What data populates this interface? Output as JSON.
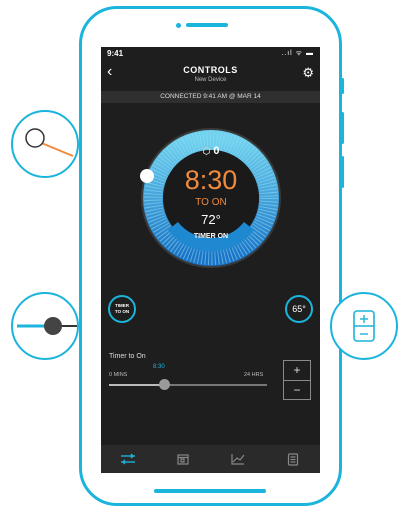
{
  "status_bar": {
    "time": "9:41",
    "signal": "..ıl ᯤ ▬"
  },
  "header": {
    "title": "CONTROLS",
    "subtitle": "New Device",
    "back_icon": "chevron-left-icon",
    "settings_icon": "gear-icon"
  },
  "connection": {
    "text": "CONNECTED 9:41 AM @ MAR 14"
  },
  "dial": {
    "count": "0",
    "count_icon": "hexagon-icon",
    "time": "8:30",
    "mode": "TO ON",
    "temperature": "72°",
    "status": "TIMER ON",
    "accent": "#1bb4dc",
    "time_color": "#f08a3c"
  },
  "left_button": {
    "line1": "TIMER",
    "line2": "TO ON"
  },
  "right_button": {
    "label": "65°"
  },
  "slider": {
    "title": "Timer to On",
    "min_label": "0 MINS",
    "max_label": "24 HRS",
    "value_label": "8:30",
    "value_fraction": 0.35
  },
  "stepper": {
    "plus": "+",
    "minus": "−"
  },
  "tabs": [
    {
      "icon": "sliders-icon",
      "active": true
    },
    {
      "icon": "calendar-icon",
      "active": false
    },
    {
      "icon": "chart-icon",
      "active": false
    },
    {
      "icon": "list-icon",
      "active": false
    }
  ],
  "callouts": [
    {
      "icon": "dial-handle-icon"
    },
    {
      "icon": "slider-icon"
    },
    {
      "icon": "stepper-icon"
    }
  ]
}
